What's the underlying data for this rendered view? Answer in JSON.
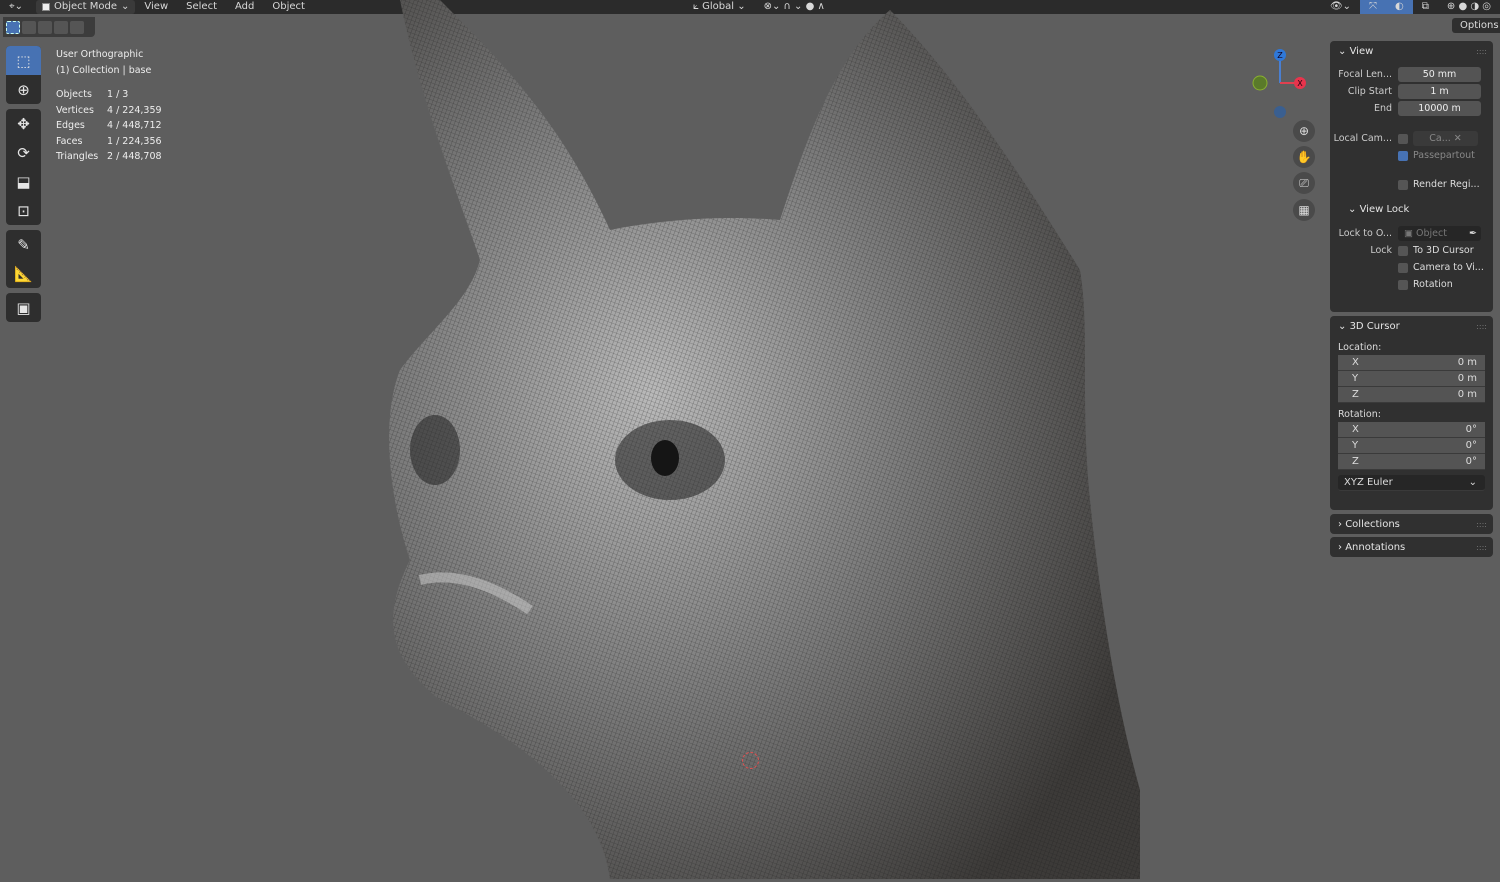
{
  "header": {
    "mode": "Object Mode",
    "menus": [
      "View",
      "Select",
      "Add",
      "Object"
    ],
    "transform_orientation": "Global",
    "options_label": "Options"
  },
  "overlay": {
    "view_name": "User Orthographic",
    "collection": "(1) Collection | base",
    "stats": [
      {
        "label": "Objects",
        "value": "1 / 3"
      },
      {
        "label": "Vertices",
        "value": "4 / 224,359"
      },
      {
        "label": "Edges",
        "value": "4 / 448,712"
      },
      {
        "label": "Faces",
        "value": "1 / 224,356"
      },
      {
        "label": "Triangles",
        "value": "2 / 448,708"
      }
    ]
  },
  "gizmo": {
    "z": "Z",
    "x": "X"
  },
  "sidebar": {
    "view": {
      "title": "View",
      "focal_label": "Focal Len...",
      "focal": "50 mm",
      "clip_start_label": "Clip Start",
      "clip_start": "1 m",
      "end_label": "End",
      "end": "10000 m",
      "local_cam_label": "Local Cam...",
      "local_cam_value": "Ca...",
      "passepartout": "Passepartout",
      "render_region": "Render Regi...",
      "view_lock": {
        "title": "View Lock",
        "lock_to_label": "Lock to O...",
        "lock_to_placeholder": "Object",
        "lock_label": "Lock",
        "to_cursor": "To 3D Cursor",
        "camera_to_view": "Camera to Vi...",
        "rotation": "Rotation"
      }
    },
    "cursor": {
      "title": "3D Cursor",
      "location_label": "Location:",
      "location": [
        {
          "axis": "X",
          "value": "0 m"
        },
        {
          "axis": "Y",
          "value": "0 m"
        },
        {
          "axis": "Z",
          "value": "0 m"
        }
      ],
      "rotation_label": "Rotation:",
      "rotation": [
        {
          "axis": "X",
          "value": "0°"
        },
        {
          "axis": "Y",
          "value": "0°"
        },
        {
          "axis": "Z",
          "value": "0°"
        }
      ],
      "rotation_mode": "XYZ Euler"
    },
    "collections": "Collections",
    "annotations": "Annotations"
  }
}
